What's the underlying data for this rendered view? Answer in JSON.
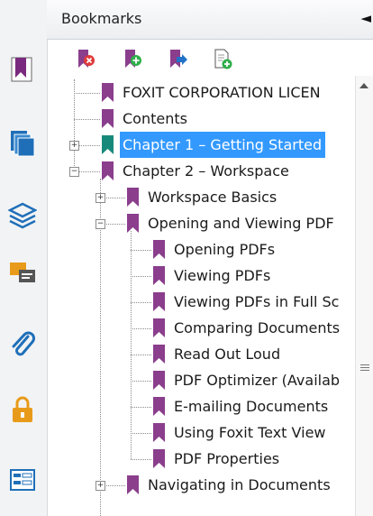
{
  "panel": {
    "title": "Bookmarks",
    "collapse_glyph": "◄"
  },
  "left_nav": [
    {
      "name": "bookmarks-panel-icon",
      "color": "#7a2a7e"
    },
    {
      "name": "pages-panel-icon",
      "color": "#1f6fb8"
    },
    {
      "name": "layers-panel-icon",
      "color": "#1f6fb8"
    },
    {
      "name": "comments-panel-icon",
      "color": "#e89b1a"
    },
    {
      "name": "attachments-panel-icon",
      "color": "#1f6fb8"
    },
    {
      "name": "security-panel-icon",
      "color": "#e89b1a"
    },
    {
      "name": "form-fields-panel-icon",
      "color": "#1f6fb8"
    }
  ],
  "toolbar": [
    {
      "name": "delete-bookmark-icon",
      "badge": "#e03b3b"
    },
    {
      "name": "new-bookmark-icon",
      "badge": "#2fae4a"
    },
    {
      "name": "go-to-bookmark-icon",
      "badge": "#2273c7"
    },
    {
      "name": "add-bookmark-from-page-icon",
      "badge": "#2fae4a"
    }
  ],
  "colors": {
    "bookmark": "#8a3e8c",
    "bookmark_selected": "#17897a",
    "selection": "#3399ff"
  },
  "bookmarks": [
    {
      "label": "FOXIT CORPORATION LICEN",
      "level": 0,
      "expander": "none"
    },
    {
      "label": "Contents",
      "level": 0,
      "expander": "none"
    },
    {
      "label": "Chapter 1 – Getting Started",
      "level": 0,
      "expander": "+",
      "selected": true
    },
    {
      "label": "Chapter 2 – Workspace",
      "level": 0,
      "expander": "−"
    },
    {
      "label": "Workspace Basics",
      "level": 1,
      "expander": "+"
    },
    {
      "label": "Opening and Viewing PDF",
      "level": 1,
      "expander": "−"
    },
    {
      "label": "Opening PDFs",
      "level": 2,
      "expander": "none"
    },
    {
      "label": "Viewing PDFs",
      "level": 2,
      "expander": "none"
    },
    {
      "label": "Viewing PDFs in Full Sc",
      "level": 2,
      "expander": "none"
    },
    {
      "label": "Comparing Documents",
      "level": 2,
      "expander": "none"
    },
    {
      "label": "Read Out Loud",
      "level": 2,
      "expander": "none"
    },
    {
      "label": "PDF Optimizer (Availab",
      "level": 2,
      "expander": "none"
    },
    {
      "label": "E-mailing Documents",
      "level": 2,
      "expander": "none"
    },
    {
      "label": "Using Foxit Text View",
      "level": 2,
      "expander": "none"
    },
    {
      "label": "PDF Properties",
      "level": 2,
      "expander": "none"
    },
    {
      "label": "Navigating in Documents",
      "level": 1,
      "expander": "+"
    }
  ]
}
